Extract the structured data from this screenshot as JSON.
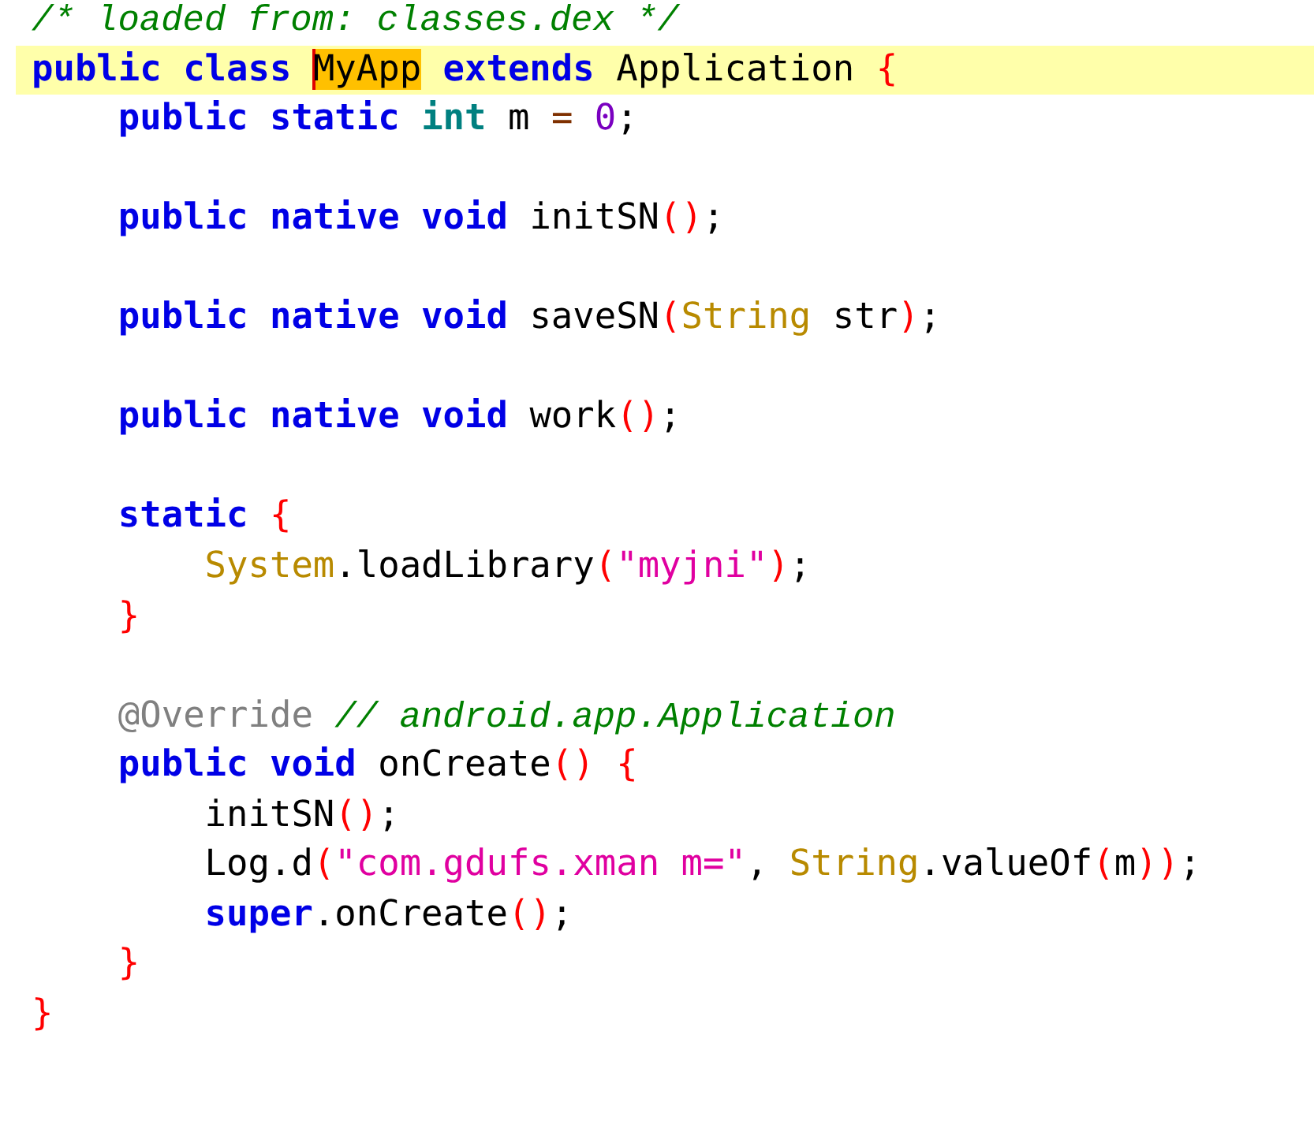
{
  "editor": {
    "lines": [
      {
        "kind": "code",
        "current": false,
        "tokens": [
          {
            "kind": "comment",
            "text": "/* loaded from: classes.dex */"
          }
        ]
      },
      {
        "kind": "code",
        "current": true,
        "tokens": [
          {
            "kind": "keyword",
            "text": "public class "
          },
          {
            "kind": "occurrence",
            "text": "MyApp"
          },
          {
            "kind": "keyword",
            "text": " extends"
          },
          {
            "kind": "plain",
            "text": " Application "
          },
          {
            "kind": "punct",
            "text": "{"
          }
        ]
      },
      {
        "kind": "code",
        "current": false,
        "tokens": [
          {
            "kind": "keyword",
            "text": "    public static "
          },
          {
            "kind": "type",
            "text": "int"
          },
          {
            "kind": "plain",
            "text": " m "
          },
          {
            "kind": "operator",
            "text": "="
          },
          {
            "kind": "number",
            "text": " 0"
          },
          {
            "kind": "plain",
            "text": ";"
          }
        ]
      },
      {
        "kind": "blank"
      },
      {
        "kind": "code",
        "current": false,
        "tokens": [
          {
            "kind": "keyword",
            "text": "    public native void "
          },
          {
            "kind": "plain",
            "text": "initSN"
          },
          {
            "kind": "punct",
            "text": "()"
          },
          {
            "kind": "plain",
            "text": ";"
          }
        ]
      },
      {
        "kind": "blank"
      },
      {
        "kind": "code",
        "current": false,
        "tokens": [
          {
            "kind": "keyword",
            "text": "    public native void "
          },
          {
            "kind": "plain",
            "text": "saveSN"
          },
          {
            "kind": "punct",
            "text": "("
          },
          {
            "kind": "classref",
            "text": "String"
          },
          {
            "kind": "plain",
            "text": " str"
          },
          {
            "kind": "punct",
            "text": ")"
          },
          {
            "kind": "plain",
            "text": ";"
          }
        ]
      },
      {
        "kind": "blank"
      },
      {
        "kind": "code",
        "current": false,
        "tokens": [
          {
            "kind": "keyword",
            "text": "    public native void "
          },
          {
            "kind": "plain",
            "text": "work"
          },
          {
            "kind": "punct",
            "text": "()"
          },
          {
            "kind": "plain",
            "text": ";"
          }
        ]
      },
      {
        "kind": "blank"
      },
      {
        "kind": "code",
        "current": false,
        "tokens": [
          {
            "kind": "keyword",
            "text": "    static "
          },
          {
            "kind": "punct",
            "text": "{"
          }
        ]
      },
      {
        "kind": "code",
        "current": false,
        "tokens": [
          {
            "kind": "classref",
            "text": "        System"
          },
          {
            "kind": "plain",
            "text": ".loadLibrary"
          },
          {
            "kind": "punct",
            "text": "("
          },
          {
            "kind": "string",
            "text": "\"myjni\""
          },
          {
            "kind": "punct",
            "text": ")"
          },
          {
            "kind": "plain",
            "text": ";"
          }
        ]
      },
      {
        "kind": "code",
        "current": false,
        "tokens": [
          {
            "kind": "punct",
            "text": "    }"
          }
        ]
      },
      {
        "kind": "blank"
      },
      {
        "kind": "code",
        "current": false,
        "tokens": [
          {
            "kind": "annotation",
            "text": "    @Override "
          },
          {
            "kind": "comment",
            "text": "// android.app.Application"
          }
        ]
      },
      {
        "kind": "code",
        "current": false,
        "tokens": [
          {
            "kind": "keyword",
            "text": "    public void "
          },
          {
            "kind": "plain",
            "text": "onCreate"
          },
          {
            "kind": "punct",
            "text": "()"
          },
          {
            "kind": "punct",
            "text": " {"
          }
        ]
      },
      {
        "kind": "code",
        "current": false,
        "tokens": [
          {
            "kind": "plain",
            "text": "        initSN"
          },
          {
            "kind": "punct",
            "text": "()"
          },
          {
            "kind": "plain",
            "text": ";"
          }
        ]
      },
      {
        "kind": "code",
        "current": false,
        "tokens": [
          {
            "kind": "plain",
            "text": "        Log.d"
          },
          {
            "kind": "punct",
            "text": "("
          },
          {
            "kind": "string",
            "text": "\"com.gdufs.xman m=\""
          },
          {
            "kind": "plain",
            "text": ", "
          },
          {
            "kind": "classref",
            "text": "String"
          },
          {
            "kind": "plain",
            "text": ".valueOf"
          },
          {
            "kind": "punct",
            "text": "("
          },
          {
            "kind": "plain",
            "text": "m"
          },
          {
            "kind": "punct",
            "text": "))"
          },
          {
            "kind": "plain",
            "text": ";"
          }
        ]
      },
      {
        "kind": "code",
        "current": false,
        "tokens": [
          {
            "kind": "keyword",
            "text": "        super"
          },
          {
            "kind": "plain",
            "text": ".onCreate"
          },
          {
            "kind": "punct",
            "text": "()"
          },
          {
            "kind": "plain",
            "text": ";"
          }
        ]
      },
      {
        "kind": "code",
        "current": false,
        "tokens": [
          {
            "kind": "punct",
            "text": "    }"
          }
        ]
      },
      {
        "kind": "code",
        "current": false,
        "tokens": [
          {
            "kind": "punct",
            "text": "}"
          }
        ]
      }
    ]
  }
}
